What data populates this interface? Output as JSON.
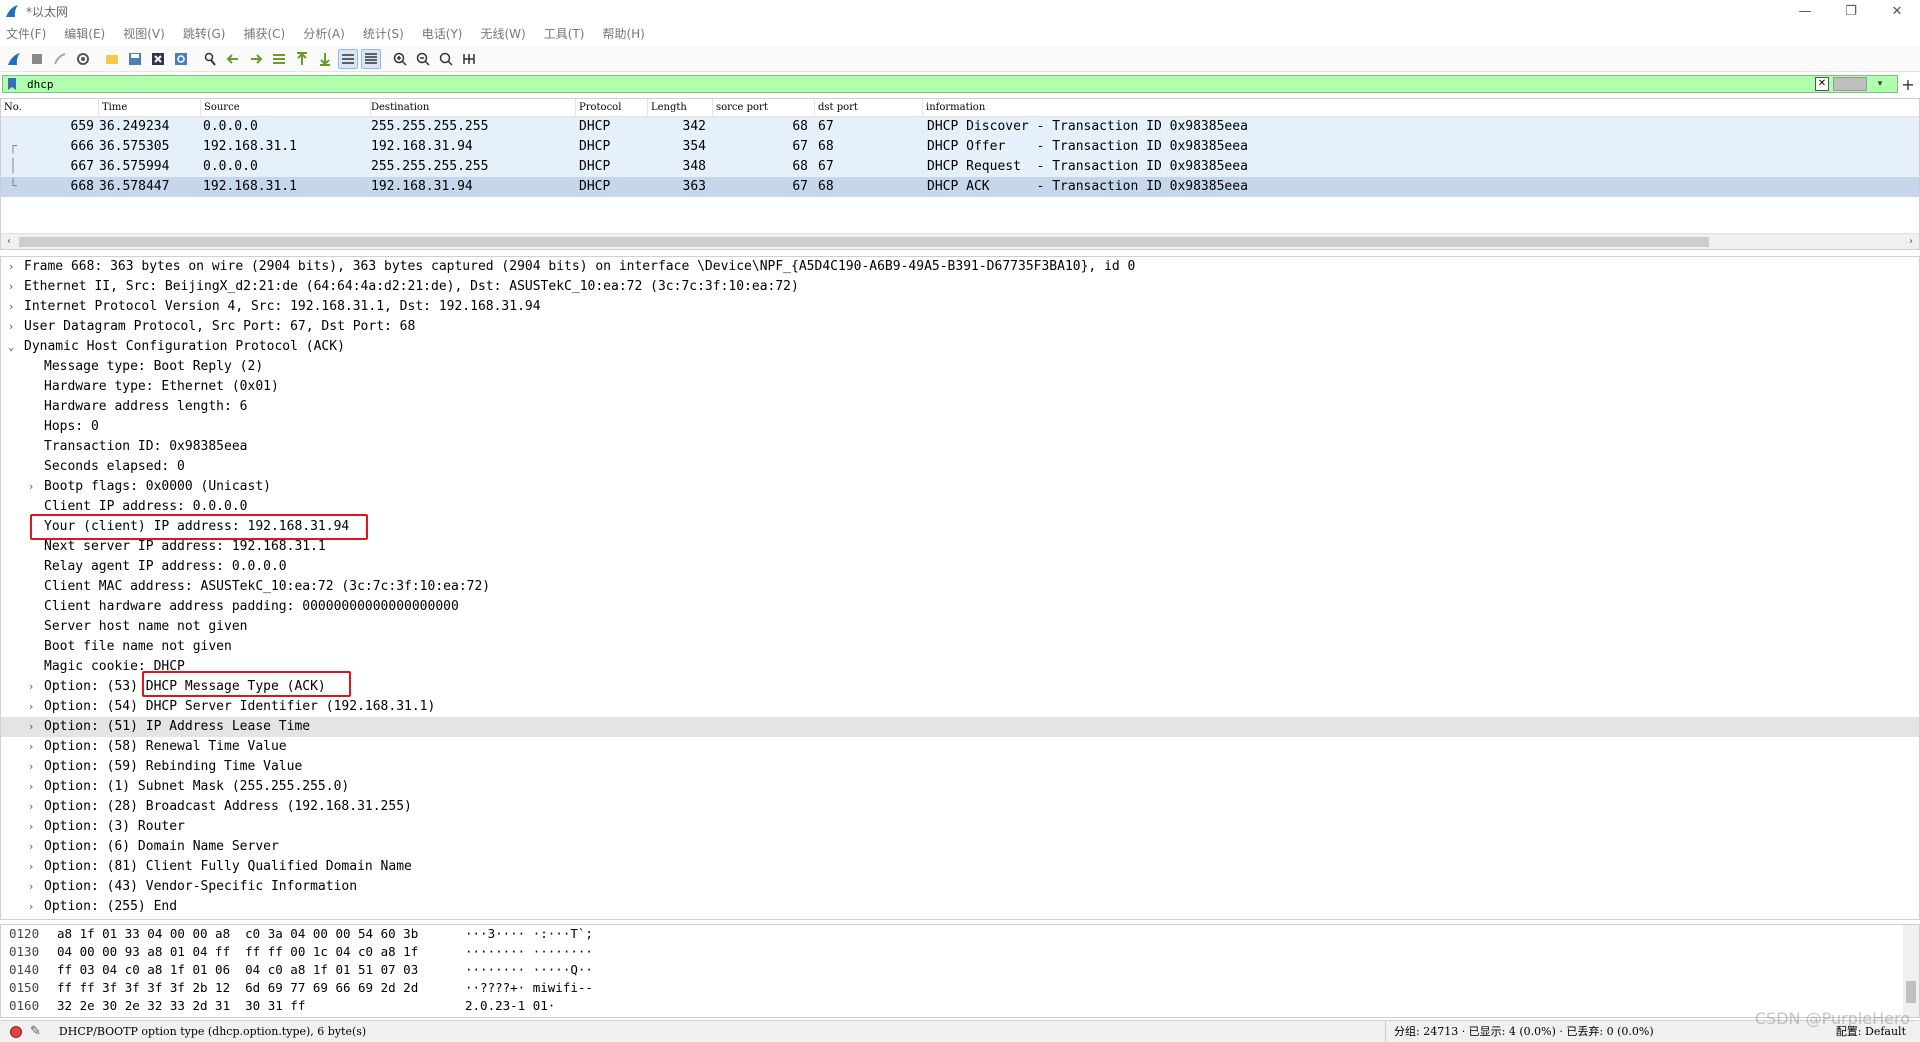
{
  "window": {
    "title": "*以太网",
    "controls": [
      "—",
      "❐",
      "✕"
    ]
  },
  "menu": [
    "文件(F)",
    "编辑(E)",
    "视图(V)",
    "跳转(G)",
    "捕获(C)",
    "分析(A)",
    "统计(S)",
    "电话(Y)",
    "无线(W)",
    "工具(T)",
    "帮助(H)"
  ],
  "filter": {
    "value": "dhcp",
    "clear_label": "✕",
    "dropdown_label": "▾",
    "add_label": "+"
  },
  "packet_list": {
    "columns": [
      "No.",
      "Time",
      "Source",
      "Destination",
      "Protocol",
      "Length",
      "sorce port",
      "dst port",
      "information"
    ],
    "rows": [
      {
        "no": "659",
        "time": "36.249234",
        "source": "0.0.0.0",
        "destination": "255.255.255.255",
        "protocol": "DHCP",
        "length": "342",
        "src_port": "68",
        "dst_port": "67",
        "info": "DHCP Discover - Transaction ID 0x98385eea",
        "selected": false
      },
      {
        "no": "666",
        "time": "36.575305",
        "source": "192.168.31.1",
        "destination": "192.168.31.94",
        "protocol": "DHCP",
        "length": "354",
        "src_port": "67",
        "dst_port": "68",
        "info": "DHCP Offer    - Transaction ID 0x98385eea",
        "selected": false
      },
      {
        "no": "667",
        "time": "36.575994",
        "source": "0.0.0.0",
        "destination": "255.255.255.255",
        "protocol": "DHCP",
        "length": "348",
        "src_port": "68",
        "dst_port": "67",
        "info": "DHCP Request  - Transaction ID 0x98385eea",
        "selected": false
      },
      {
        "no": "668",
        "time": "36.578447",
        "source": "192.168.31.1",
        "destination": "192.168.31.94",
        "protocol": "DHCP",
        "length": "363",
        "src_port": "67",
        "dst_port": "68",
        "info": "DHCP ACK      - Transaction ID 0x98385eea",
        "selected": true
      }
    ]
  },
  "details": [
    {
      "text": "Frame 668: 363 bytes on wire (2904 bits), 363 bytes captured (2904 bits) on interface \\Device\\NPF_{A5D4C190-A6B9-49A5-B391-D67735F3BA10}, id 0",
      "level": 0,
      "arrow": "›",
      "highlight": false
    },
    {
      "text": "Ethernet II, Src: BeijingX_d2:21:de (64:64:4a:d2:21:de), Dst: ASUSTekC_10:ea:72 (3c:7c:3f:10:ea:72)",
      "level": 0,
      "arrow": "›",
      "highlight": false
    },
    {
      "text": "Internet Protocol Version 4, Src: 192.168.31.1, Dst: 192.168.31.94",
      "level": 0,
      "arrow": "›",
      "highlight": false
    },
    {
      "text": "User Datagram Protocol, Src Port: 67, Dst Port: 68",
      "level": 0,
      "arrow": "›",
      "highlight": false
    },
    {
      "text": "Dynamic Host Configuration Protocol (ACK)",
      "level": 0,
      "arrow": "⌄",
      "highlight": false
    },
    {
      "text": "Message type: Boot Reply (2)",
      "level": 1,
      "arrow": "",
      "highlight": false
    },
    {
      "text": "Hardware type: Ethernet (0x01)",
      "level": 1,
      "arrow": "",
      "highlight": false
    },
    {
      "text": "Hardware address length: 6",
      "level": 1,
      "arrow": "",
      "highlight": false
    },
    {
      "text": "Hops: 0",
      "level": 1,
      "arrow": "",
      "highlight": false
    },
    {
      "text": "Transaction ID: 0x98385eea",
      "level": 1,
      "arrow": "",
      "highlight": false
    },
    {
      "text": "Seconds elapsed: 0",
      "level": 1,
      "arrow": "",
      "highlight": false
    },
    {
      "text": "Bootp flags: 0x0000 (Unicast)",
      "level": 1,
      "arrow": "›",
      "highlight": false
    },
    {
      "text": "Client IP address: 0.0.0.0",
      "level": 1,
      "arrow": "",
      "highlight": false
    },
    {
      "text": "Your (client) IP address: 192.168.31.94",
      "level": 1,
      "arrow": "",
      "highlight": false
    },
    {
      "text": "Next server IP address: 192.168.31.1",
      "level": 1,
      "arrow": "",
      "highlight": false
    },
    {
      "text": "Relay agent IP address: 0.0.0.0",
      "level": 1,
      "arrow": "",
      "highlight": false
    },
    {
      "text": "Client MAC address: ASUSTekC_10:ea:72 (3c:7c:3f:10:ea:72)",
      "level": 1,
      "arrow": "",
      "highlight": false
    },
    {
      "text": "Client hardware address padding: 00000000000000000000",
      "level": 1,
      "arrow": "",
      "highlight": false
    },
    {
      "text": "Server host name not given",
      "level": 1,
      "arrow": "",
      "highlight": false
    },
    {
      "text": "Boot file name not given",
      "level": 1,
      "arrow": "",
      "highlight": false
    },
    {
      "text": "Magic cookie: DHCP",
      "level": 1,
      "arrow": "",
      "highlight": false
    },
    {
      "text": "Option: (53) DHCP Message Type (ACK)",
      "level": 1,
      "arrow": "›",
      "highlight": false
    },
    {
      "text": "Option: (54) DHCP Server Identifier (192.168.31.1)",
      "level": 1,
      "arrow": "›",
      "highlight": false
    },
    {
      "text": "Option: (51) IP Address Lease Time",
      "level": 1,
      "arrow": "›",
      "highlight": true
    },
    {
      "text": "Option: (58) Renewal Time Value",
      "level": 1,
      "arrow": "›",
      "highlight": false
    },
    {
      "text": "Option: (59) Rebinding Time Value",
      "level": 1,
      "arrow": "›",
      "highlight": false
    },
    {
      "text": "Option: (1) Subnet Mask (255.255.255.0)",
      "level": 1,
      "arrow": "›",
      "highlight": false
    },
    {
      "text": "Option: (28) Broadcast Address (192.168.31.255)",
      "level": 1,
      "arrow": "›",
      "highlight": false
    },
    {
      "text": "Option: (3) Router",
      "level": 1,
      "arrow": "›",
      "highlight": false
    },
    {
      "text": "Option: (6) Domain Name Server",
      "level": 1,
      "arrow": "›",
      "highlight": false
    },
    {
      "text": "Option: (81) Client Fully Qualified Domain Name",
      "level": 1,
      "arrow": "›",
      "highlight": false
    },
    {
      "text": "Option: (43) Vendor-Specific Information",
      "level": 1,
      "arrow": "›",
      "highlight": false
    },
    {
      "text": "Option: (255) End",
      "level": 1,
      "arrow": "›",
      "highlight": false
    }
  ],
  "bytes": [
    {
      "offset": "0120",
      "hex": "a8 1f 01 33 04 00 00 a8  c0 3a 04 00 00 54 60 3b",
      "ascii": "···3···· ·:···T`;"
    },
    {
      "offset": "0130",
      "hex": "04 00 00 93 a8 01 04 ff  ff ff 00 1c 04 c0 a8 1f",
      "ascii": "········ ········"
    },
    {
      "offset": "0140",
      "hex": "ff 03 04 c0 a8 1f 01 06  04 c0 a8 1f 01 51 07 03",
      "ascii": "········ ·····Q··"
    },
    {
      "offset": "0150",
      "hex": "ff ff 3f 3f 3f 3f 2b 12  6d 69 77 69 66 69 2d 2d",
      "ascii": "··????+· miwifi--"
    },
    {
      "offset": "0160",
      "hex": "32 2e 30 2e 32 33 2d 31  30 31 ff",
      "ascii": "2.0.23-1 01·"
    }
  ],
  "status": {
    "field_info": "DHCP/BOOTP option type (dhcp.option.type), 6 byte(s)",
    "packets_info": "分组: 24713 · 已显示: 4 (0.0%) · 已丢弃: 0 (0.0%)",
    "profile": "配置: Default",
    "watermark": "CSDN @PurpleHero"
  },
  "colors": {
    "filter_bg": "#afffaf",
    "row_bg": "#e6f0fa",
    "row_selected_bg": "#c6d7eb",
    "annotation_box": "#e0141e"
  }
}
